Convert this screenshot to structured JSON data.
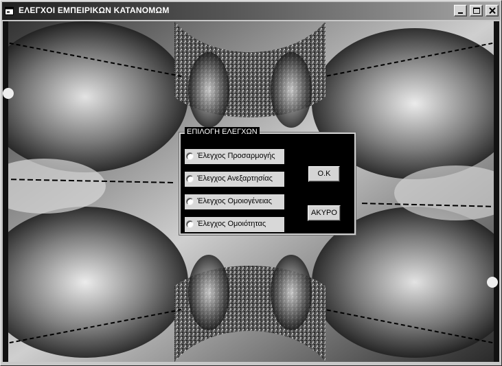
{
  "window": {
    "title": "ΕΛΕΓΧΟΙ ΕΜΠΕΙΡΙΚΩΝ ΚΑΤΑΝΟΜΩΜ",
    "controls": [
      "minimize-icon",
      "maximize-icon",
      "close-icon"
    ]
  },
  "frame": {
    "caption": "ΕΠΙΛΟΓΗ ΕΛΕΓΧΩΝ",
    "options": [
      {
        "label": "Έλεγχος Προσαρμογής",
        "selected": false
      },
      {
        "label": "Έλεγχος Ανεξαρτησίας",
        "selected": false
      },
      {
        "label": "Έλεγχος Ομοιογένειας",
        "selected": false
      },
      {
        "label": "Έλεγχος Ομοιότητας",
        "selected": false
      }
    ],
    "ok_label": "O.K",
    "cancel_label": "ΑΚΥΡΟ"
  },
  "colors": {
    "titlebar_start": "#202020",
    "titlebar_end": "#a6a6a6",
    "frame_background": "#000000",
    "option_background": "#d8d8d8"
  }
}
